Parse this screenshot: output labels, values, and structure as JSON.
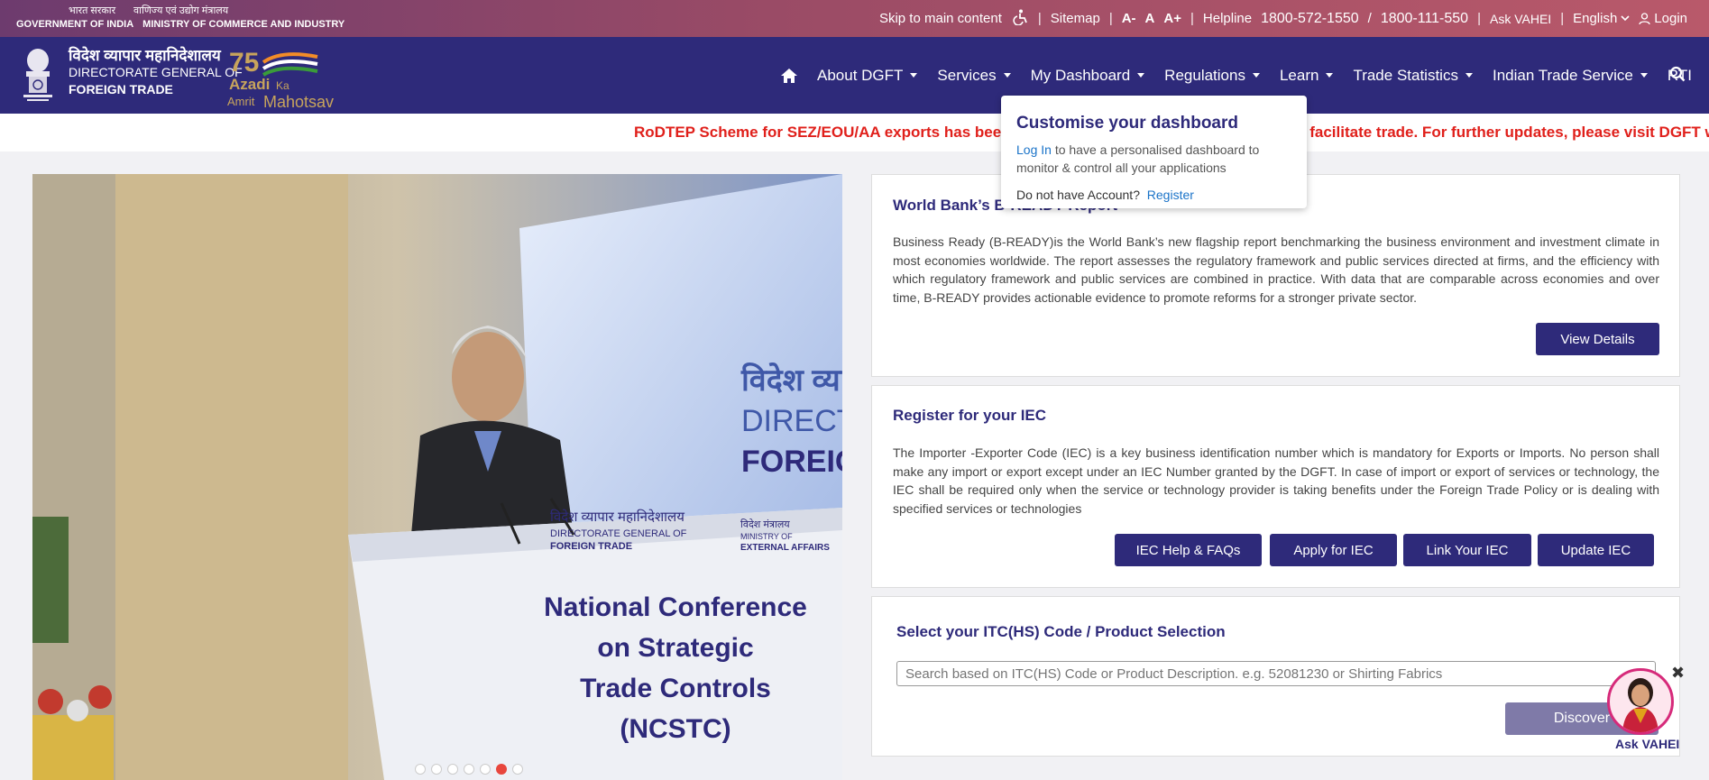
{
  "topbar": {
    "gov_hi": "भारत सरकार",
    "ministry_hi": "वाणिज्य एवं उद्योग मंत्रालय",
    "gov_en": "GOVERNMENT OF INDIA",
    "ministry_en": "MINISTRY OF COMMERCE AND INDUSTRY",
    "skip": "Skip to main content",
    "sitemap": "Sitemap",
    "font_small": "A-",
    "font_normal": "A",
    "font_large": "A+",
    "helpline_label": "Helpline",
    "helpline_1": "1800-572-1550",
    "helpline_sep": "/",
    "helpline_2": "1800-111-550",
    "ask": "Ask VAHEI",
    "language": "English",
    "login": "Login"
  },
  "brand": {
    "name_hi": "विदेश व्यापार महानिदेशालय",
    "name_en_1": "DIRECTORATE GENERAL OF",
    "name_en_2": "FOREIGN TRADE",
    "azadi_1": "Azadi",
    "azadi_ka": "Ka",
    "azadi_2": "Amrit",
    "azadi_3": "Mahotsav"
  },
  "nav": {
    "items": [
      {
        "label": "About DGFT"
      },
      {
        "label": "Services"
      },
      {
        "label": "My Dashboard"
      },
      {
        "label": "Regulations"
      },
      {
        "label": "Learn"
      },
      {
        "label": "Trade Statistics"
      },
      {
        "label": "Indian Trade Service"
      },
      {
        "label": "RTI"
      }
    ]
  },
  "ticker": {
    "text": "RoDTEP Scheme for SEZ/EOU/AA exports has been extended till 05.02.2025 as a measure to facilitate trade. For further updates, please visit DGFT website"
  },
  "dropdown": {
    "title": "Customise your dashboard",
    "login_link": "Log In",
    "desc": " to have a personalised dashboard to monitor & control all your applications",
    "no_account": "Do not have Account?",
    "register": "Register"
  },
  "cards": {
    "bready": {
      "title": "World Bank’s B-READY Report",
      "body": "Business Ready (B-READY)is the World Bank’s new flagship report benchmarking the business environment and investment climate in most economies worldwide. The report assesses the regulatory framework and public services directed at firms, and the efficiency with which regulatory framework and public services are combined in practice. With data that are comparable across economies and over time, B-READY provides actionable evidence to promote reforms for a stronger private sector.",
      "button": "View Details"
    },
    "iec": {
      "title": "Register for your IEC",
      "body": "The Importer -Exporter Code (IEC) is a key business identification number which is mandatory for Exports or Imports. No person shall make any import or export except under an IEC Number granted by the DGFT. In case of import or export of services or technology, the IEC shall be required only when the service or technology provider is taking benefits under the Foreign Trade Policy or is dealing with specified services or technologies",
      "buttons": [
        "IEC Help & FAQs",
        "Apply for IEC",
        "Link Your IEC",
        "Update IEC"
      ]
    },
    "hs": {
      "title": "Select your ITC(HS) Code / Product Selection",
      "placeholder": "Search based on ITC(HS) Code or Product Description. e.g. 52081230 or Shirting Fabrics",
      "button": "Discover"
    }
  },
  "slider": {
    "podium_hi": "विदेश व्यापार महानिदेशालय",
    "podium_en_1": "DIRECTORATE GENERAL OF",
    "podium_en_2": "FOREIGN TRADE",
    "mea_hi": "विदेश मंत्रालय",
    "mea_en_1": "MINISTRY OF",
    "mea_en_2": "EXTERNAL AFFAIRS",
    "banner_1": "National Conference",
    "banner_2": "on Strategic",
    "banner_3": "Trade Controls",
    "banner_4": "(NCSTC)",
    "bg_hi": "विदेश व्याप",
    "bg_en_1": "DIRECTO",
    "bg_en_2": "FOREIGN",
    "slides": 7,
    "active_slide": 6
  },
  "vahei": {
    "label": "Ask VAHEI"
  }
}
